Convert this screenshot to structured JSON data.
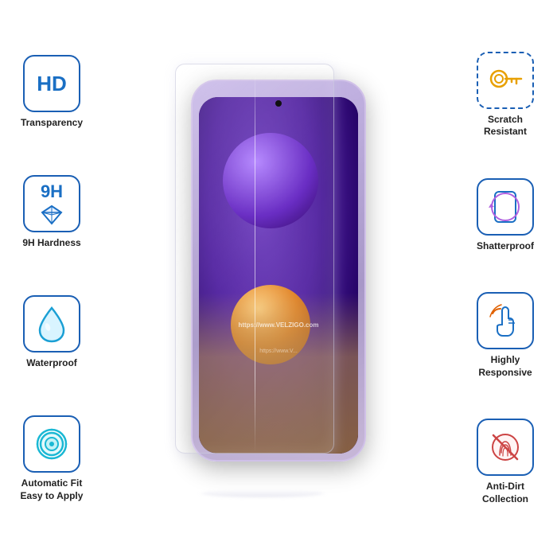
{
  "features": {
    "left": [
      {
        "id": "hd-transparency",
        "icon_type": "hd",
        "label": "Transparency"
      },
      {
        "id": "9h-hardness",
        "icon_type": "9h",
        "label": "9H Hardness"
      },
      {
        "id": "waterproof",
        "icon_type": "water",
        "label": "Waterproof"
      },
      {
        "id": "auto-fit",
        "icon_type": "autofit",
        "label_line1": "Automatic Fit",
        "label_line2": "Easy to Apply",
        "label": "Automatic Fit\nEasy to Apply"
      }
    ],
    "right": [
      {
        "id": "scratch-resistant",
        "icon_type": "key",
        "label_line1": "Scratch",
        "label_line2": "Resistant",
        "label": "Scratch\nResistant"
      },
      {
        "id": "shatterproof",
        "icon_type": "shatter",
        "label": "Shatterproof"
      },
      {
        "id": "highly-responsive",
        "icon_type": "touch",
        "label_line1": "Highly",
        "label_line2": "Responsive",
        "label": "Highly\nResponsive"
      },
      {
        "id": "anti-dirt",
        "icon_type": "antidirt",
        "label_line1": "Anti-Dirt",
        "label_line2": "Collection",
        "label": "Anti-Dirt\nCollection"
      }
    ]
  },
  "watermark": "https://www.VELZIGO.com",
  "watermark2": "https://www.V..."
}
